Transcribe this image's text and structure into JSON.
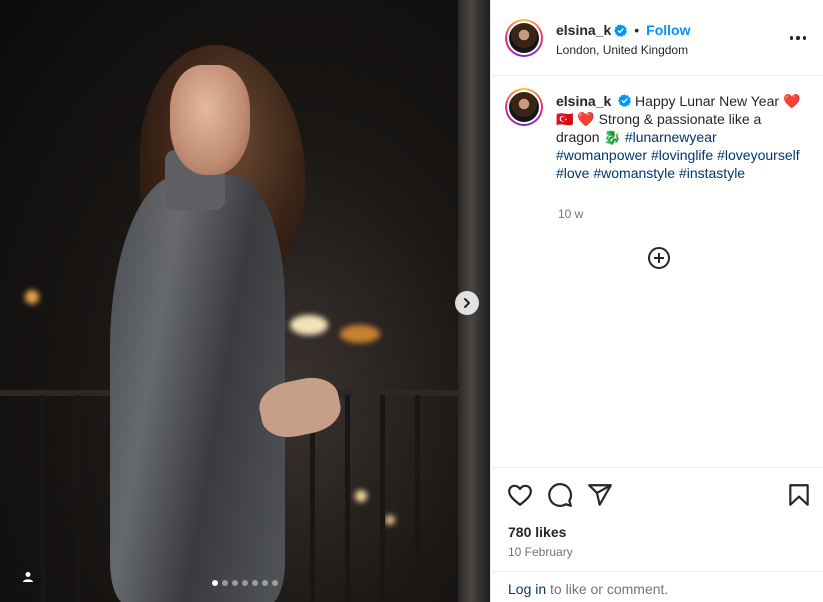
{
  "post": {
    "slide_count": 7,
    "active_slide": 1
  },
  "header": {
    "username": "elsina_k",
    "separator": "•",
    "follow_label": "Follow",
    "location": "London, United Kingdom"
  },
  "caption": {
    "username": "elsina_k",
    "text_1": "Happy Lunar New Year",
    "heart_1": "❤️",
    "flag": "🇹🇷",
    "heart_2": "❤️",
    "text_2": "Strong & passionate like a dragon",
    "dragon": "🐉",
    "hashtags": [
      "#lunarnewyear",
      "#womanpower",
      "#lovinglife",
      "#loveyourself",
      "#love",
      "#womanstyle",
      "#instastyle"
    ],
    "time": "10 w"
  },
  "footer_stats": {
    "likes": "780 likes",
    "date": "10 February"
  },
  "login_prompt": {
    "link": "Log in",
    "rest": " to like or comment."
  },
  "colors": {
    "accent": "#0095f6",
    "hashtag": "#00376b",
    "muted": "#737373"
  },
  "icons": [
    "verified-badge-icon",
    "more-options-icon",
    "add-comment-icon",
    "heart-icon",
    "comment-icon",
    "share-icon",
    "bookmark-icon",
    "chevron-right-icon",
    "user-tag-icon"
  ]
}
